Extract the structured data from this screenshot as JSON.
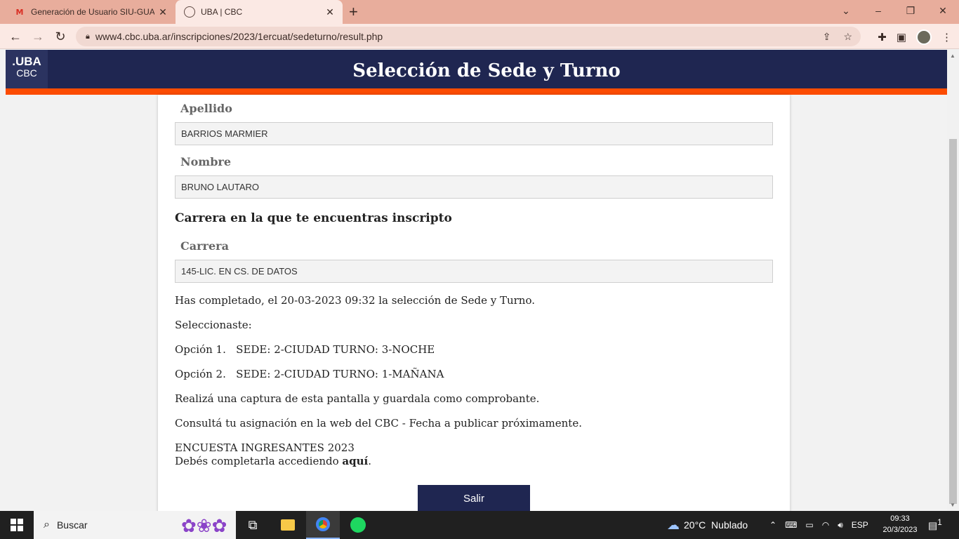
{
  "browser": {
    "tabs": [
      {
        "title": "Generación de Usuario SIU-GUARANÍ",
        "icon": "gmail-icon"
      },
      {
        "title": "UBA | CBC",
        "icon": "globe-icon"
      }
    ],
    "new_tab": "+",
    "url": "www4.cbc.uba.ar/inscripciones/2023/1ercuat/sedeturno/result.php"
  },
  "header": {
    "logo_top": ".UBA",
    "logo_bottom": "CBC",
    "title": "Selección de Sede y Turno",
    "colors": {
      "navy": "#1f2651",
      "orange": "#fc4c02"
    }
  },
  "form": {
    "apellido_label": "Apellido",
    "apellido_value": "BARRIOS MARMIER",
    "nombre_label": "Nombre",
    "nombre_value": "BRUNO LAUTARO",
    "section_title": "Carrera en la que te encuentras inscripto",
    "carrera_label": "Carrera",
    "carrera_value": "145-LIC. EN CS. DE DATOS"
  },
  "result": {
    "completed": "Has completado, el 20-03-2023 09:32 la selección de Sede y Turno.",
    "selected": "Seleccionaste:",
    "option1": "Opción 1.   SEDE: 2-CIUDAD TURNO: 3-NOCHE",
    "option2": "Opción 2.   SEDE: 2-CIUDAD TURNO: 1-MAÑANA",
    "capture": "Realizá una captura de esta pantalla y guardala como comprobante.",
    "consult": "Consultá tu asignación en la web del CBC - Fecha a publicar próximamente.",
    "survey_title": "ENCUESTA INGRESANTES 2023",
    "survey_text": "Debés completarla accediendo ",
    "survey_link": "aquí",
    "survey_end": ".",
    "exit_button": "Salir"
  },
  "taskbar": {
    "search": "Buscar",
    "weather": "20°C  Nublado",
    "lang": "ESP",
    "time": "09:33",
    "date": "20/3/2023",
    "notifications": "1"
  }
}
